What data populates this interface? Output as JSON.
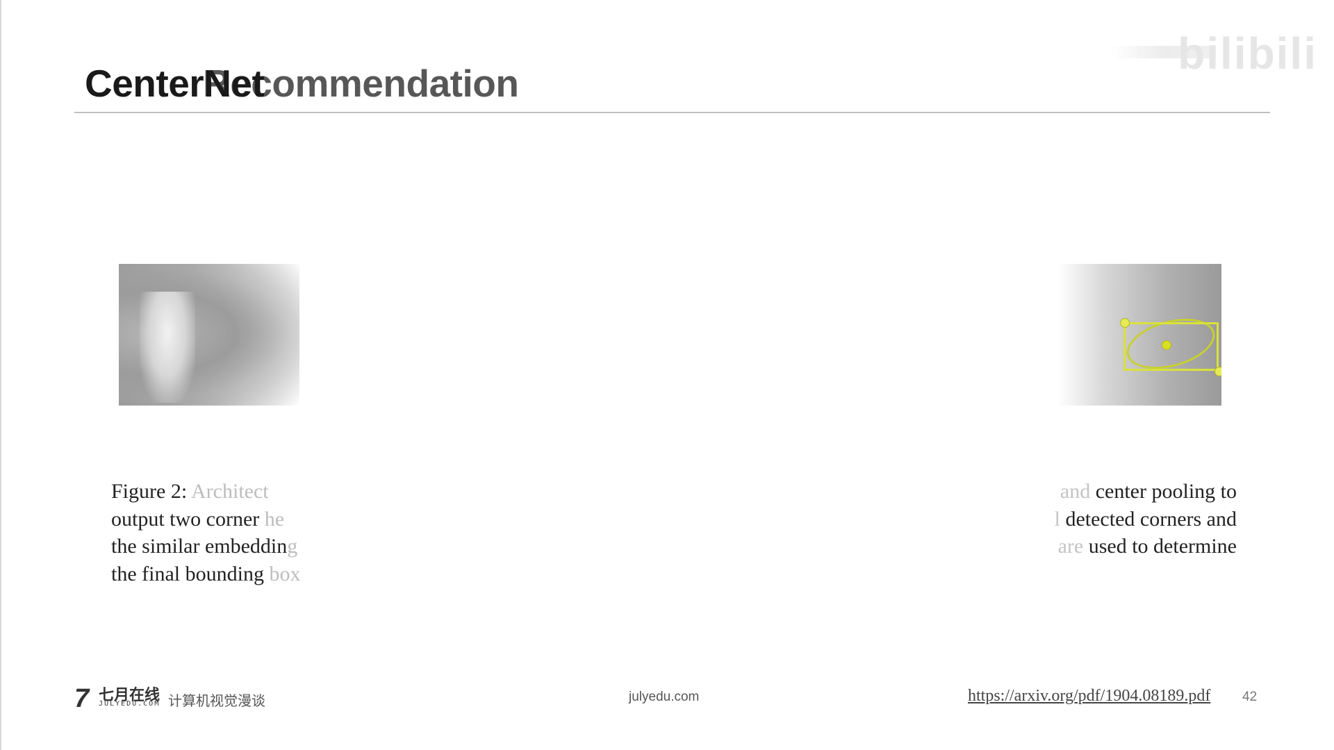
{
  "slide": {
    "title": "CenterNet",
    "title_overlay": "Recommendation",
    "watermark": "bilibili",
    "page_number": "42"
  },
  "figures": {
    "left": {
      "description_icon": "photo-person"
    },
    "right": {
      "description_icon": "photo-detection",
      "accent_color": "#d9e23a"
    }
  },
  "caption": {
    "lines": [
      {
        "left_strong": "Figure 2: ",
        "left_fade": "Architect",
        "right_fade": "and ",
        "right_strong": "center pooling to"
      },
      {
        "left_strong": "output two corner ",
        "left_fade": "he",
        "right_fade": "l ",
        "right_strong": "detected corners and"
      },
      {
        "left_strong": "the similar embeddin",
        "left_fade": "g",
        "right_fade": "are ",
        "right_strong": "used to determine"
      },
      {
        "left_strong": "the final bounding ",
        "left_fade": "box",
        "right_fade": "",
        "right_strong": ""
      }
    ]
  },
  "footer": {
    "logo_mark": "7",
    "logo_cn": "七月在线",
    "logo_en": "JULYEDU.COM",
    "logo_sub": "计算机视觉漫谈",
    "center_text": "julyedu.com",
    "link": "https://arxiv.org/pdf/1904.08189.pdf"
  }
}
